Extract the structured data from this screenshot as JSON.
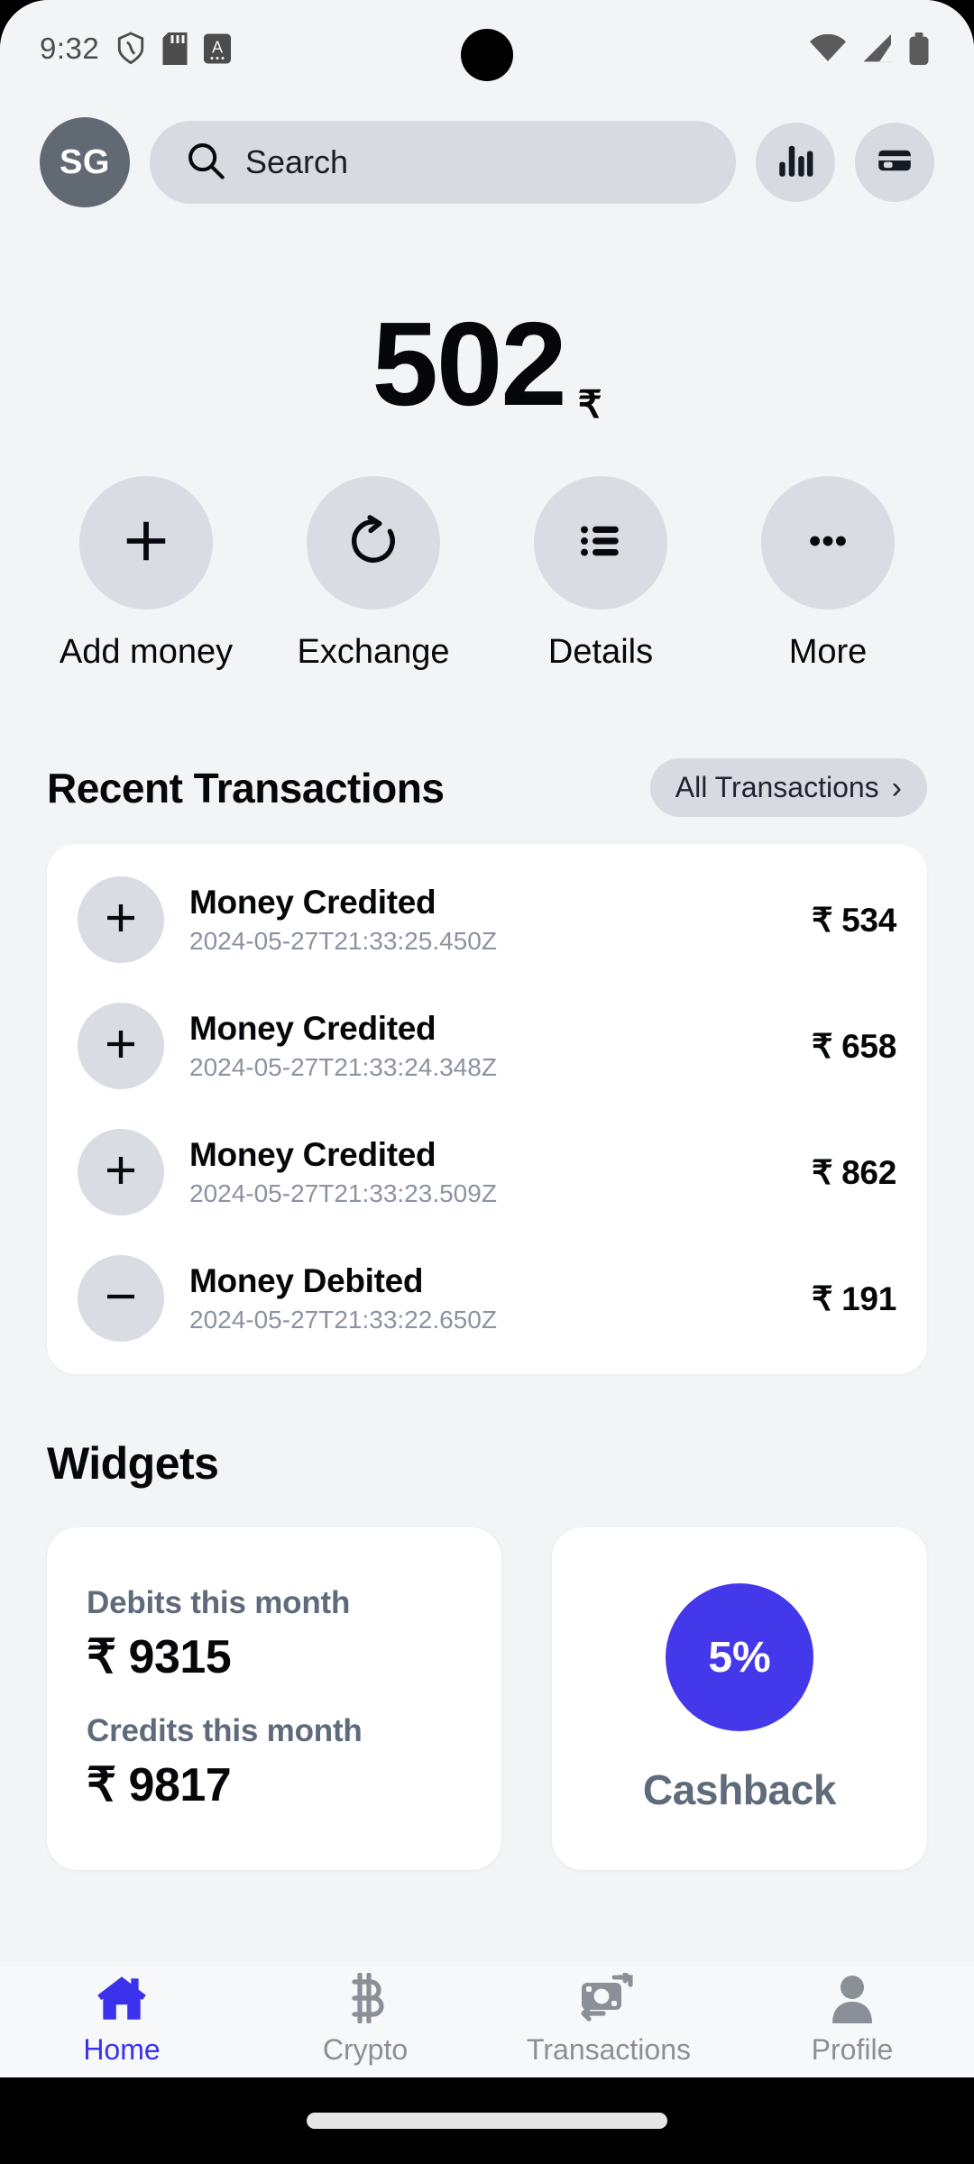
{
  "status_bar": {
    "time": "9:32",
    "left_icons": [
      "shield-icon",
      "sd-card-icon",
      "letter-a-icon"
    ],
    "right_icons": [
      "wifi-icon",
      "cellular-signal-icon",
      "battery-icon"
    ]
  },
  "header": {
    "avatar_initials": "SG",
    "search_placeholder": "Search",
    "stats_button_icon": "bar-chart-icon",
    "card_button_icon": "credit-card-icon"
  },
  "balance": {
    "amount": "502",
    "currency_symbol": "₹"
  },
  "actions": [
    {
      "label": "Add money",
      "icon": "plus-icon"
    },
    {
      "label": "Exchange",
      "icon": "refresh-rotate-icon"
    },
    {
      "label": "Details",
      "icon": "list-icon"
    },
    {
      "label": "More",
      "icon": "ellipsis-icon"
    }
  ],
  "recent_transactions": {
    "title": "Recent Transactions",
    "all_link_label": "All Transactions",
    "all_link_chevron": "›",
    "items": [
      {
        "title": "Money Credited",
        "date": "2024-05-27T21:33:25.450Z",
        "amount": "₹ 534",
        "icon": "plus-icon",
        "type": "credit"
      },
      {
        "title": "Money Credited",
        "date": "2024-05-27T21:33:24.348Z",
        "amount": "₹ 658",
        "icon": "plus-icon",
        "type": "credit"
      },
      {
        "title": "Money Credited",
        "date": "2024-05-27T21:33:23.509Z",
        "amount": "₹ 862",
        "icon": "plus-icon",
        "type": "credit"
      },
      {
        "title": "Money Debited",
        "date": "2024-05-27T21:33:22.650Z",
        "amount": "₹ 191",
        "icon": "minus-icon",
        "type": "debit"
      }
    ]
  },
  "widgets": {
    "title": "Widgets",
    "stats": {
      "debits_label": "Debits this month",
      "debits_value": "₹ 9315",
      "credits_label": "Credits this month",
      "credits_value": "₹ 9817"
    },
    "cashback": {
      "percent": "5%",
      "label": "Cashback",
      "accent_color": "#4338ea"
    }
  },
  "bottom_nav": {
    "active_color": "#3b32ee",
    "inactive_color": "#8b8f97",
    "items": [
      {
        "label": "Home",
        "icon": "home-icon",
        "active": true
      },
      {
        "label": "Crypto",
        "icon": "bitcoin-icon",
        "active": false
      },
      {
        "label": "Transactions",
        "icon": "money-exchange-icon",
        "active": false
      },
      {
        "label": "Profile",
        "icon": "person-icon",
        "active": false
      }
    ]
  }
}
